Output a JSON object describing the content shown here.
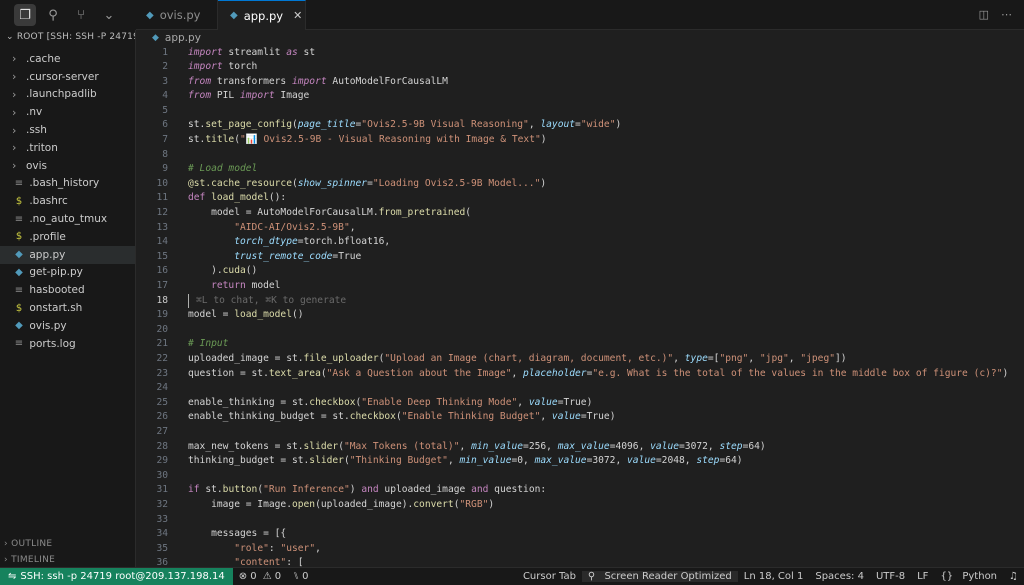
{
  "activitybar": {
    "icons": [
      "files-icon",
      "search-icon",
      "source-control-icon",
      "chevron-down-icon"
    ]
  },
  "sidebar": {
    "root_label": "ROOT [SSH: SSH -P 24719 ...",
    "items": [
      {
        "type": "folder",
        "label": ".cache"
      },
      {
        "type": "folder",
        "label": ".cursor-server"
      },
      {
        "type": "folder",
        "label": ".launchpadlib"
      },
      {
        "type": "folder",
        "label": ".nv"
      },
      {
        "type": "folder",
        "label": ".ssh"
      },
      {
        "type": "folder",
        "label": ".triton"
      },
      {
        "type": "folder",
        "label": "ovis"
      },
      {
        "type": "file",
        "icon": "≡",
        "label": ".bash_history"
      },
      {
        "type": "file",
        "icon": "$",
        "label": ".bashrc"
      },
      {
        "type": "file",
        "icon": "≡",
        "label": ".no_auto_tmux"
      },
      {
        "type": "file",
        "icon": "$",
        "label": ".profile"
      },
      {
        "type": "file",
        "icon": "py",
        "label": "app.py"
      },
      {
        "type": "file",
        "icon": "py",
        "label": "get-pip.py"
      },
      {
        "type": "file",
        "icon": "≡",
        "label": "hasbooted"
      },
      {
        "type": "file",
        "icon": "$",
        "label": "onstart.sh"
      },
      {
        "type": "file",
        "icon": "py",
        "label": "ovis.py"
      },
      {
        "type": "file",
        "icon": "≡",
        "label": "ports.log"
      }
    ],
    "outline": "OUTLINE",
    "timeline": "TIMELINE"
  },
  "tabs": [
    {
      "label": "ovis.py",
      "active": false
    },
    {
      "label": "app.py",
      "active": true
    }
  ],
  "breadcrumb": "app.py",
  "editor": {
    "current_line": 18,
    "inline_hint": "⌘L to chat, ⌘K to generate",
    "line_numbers": [
      "1",
      "2",
      "3",
      "4",
      "5",
      "6",
      "7",
      "8",
      "9",
      "10",
      "11",
      "12",
      "13",
      "14",
      "15",
      "16",
      "17",
      "18",
      "19",
      "20",
      "21",
      "22",
      "23",
      "24",
      "25",
      "26",
      "27",
      "28",
      "29",
      "30",
      "31",
      "32",
      "33",
      "34",
      "35",
      "36"
    ]
  },
  "status": {
    "remote": "SSH: ssh -p 24719 root@209.137.198.14",
    "errors": "0",
    "warnings": "0",
    "ports": "0",
    "cursor_tab": "Cursor Tab",
    "screen_reader": "Screen Reader Optimized",
    "position": "Ln 18, Col 1",
    "spaces": "Spaces: 4",
    "encoding": "UTF-8",
    "eol": "LF",
    "language": "Python",
    "accent": "#16825d"
  }
}
